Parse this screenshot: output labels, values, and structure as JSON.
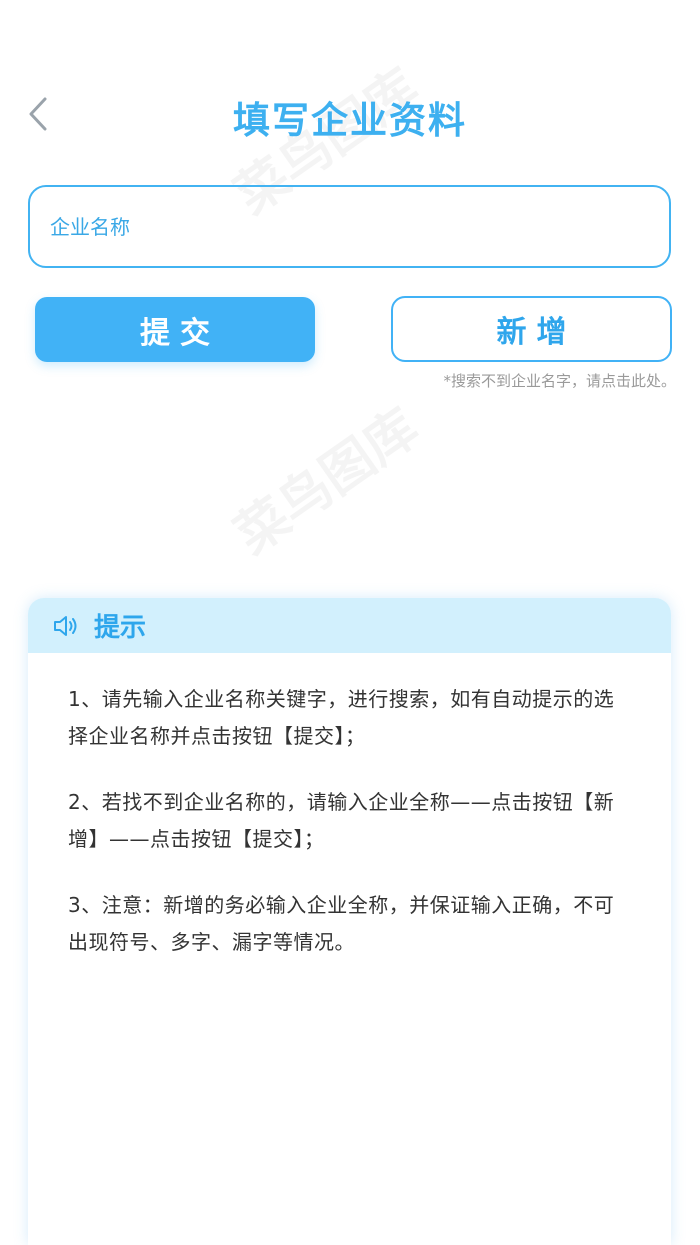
{
  "header": {
    "title": "填写企业资料"
  },
  "form": {
    "company_name_placeholder": "企业名称"
  },
  "actions": {
    "submit_label": "提交",
    "add_label": "新增",
    "hint": "*搜索不到企业名字，请点击此处。"
  },
  "tips": {
    "title": "提示",
    "items": [
      "1、请先输入企业名称关键字，进行搜索，如有自动提示的选择企业名称并点击按钮【提交】；",
      "2、若找不到企业名称的，请输入企业全称——点击按钮【新增】——点击按钮【提交】；",
      "3、注意：新增的务必输入企业全称，并保证输入正确，不可出现符号、多字、漏字等情况。"
    ]
  },
  "watermark": "菜鸟图库",
  "colors": {
    "accent": "#41b2f6",
    "title": "#3db0f0",
    "tips_header_bg": "#d2f0fd"
  }
}
